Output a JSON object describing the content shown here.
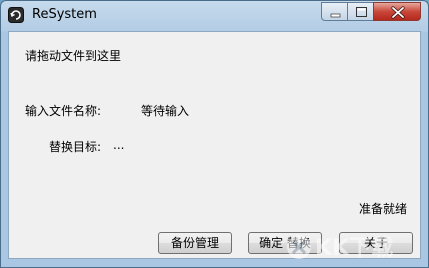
{
  "window": {
    "title": "ReSystem"
  },
  "main": {
    "instruction": "请拖动文件到这里",
    "input_file_label": "输入文件名称:",
    "input_file_value": "等待输入",
    "replace_target_label": "替换目标:",
    "replace_target_value": "...",
    "status": "准备就绪"
  },
  "buttons": {
    "backup_manage": "备份管理",
    "confirm_replace": "确定 替换",
    "close": "关于"
  },
  "watermark": {
    "text": "KK下载"
  },
  "colors": {
    "close_button": "#c9483a",
    "titlebar": "#b3cde5",
    "client_bg": "#f0f0f0"
  }
}
